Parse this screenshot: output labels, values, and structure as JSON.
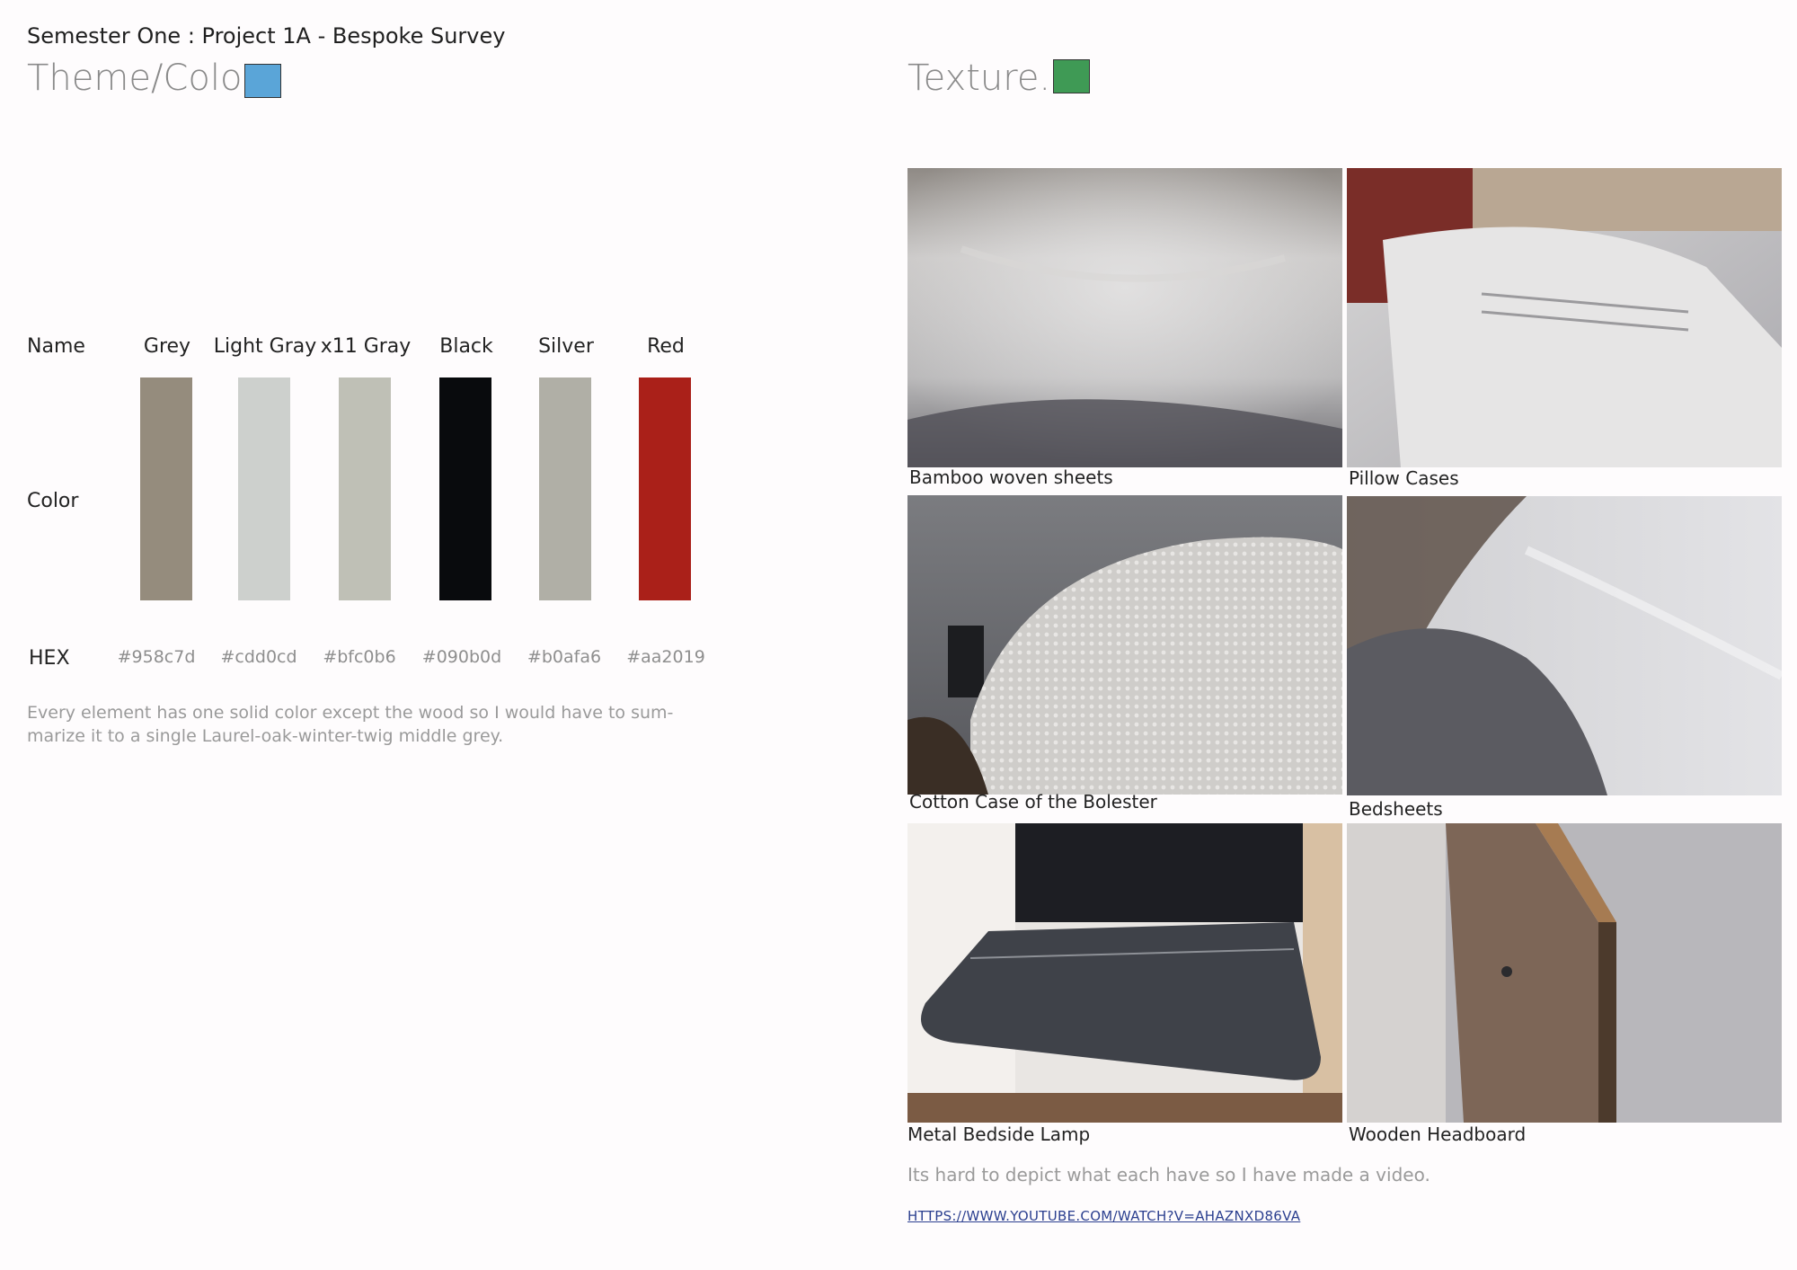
{
  "header": {
    "project_title": "Semester One : Project 1A - Bespoke Survey"
  },
  "theme": {
    "title": "Theme/Color",
    "title_square_color": "#5aa5d8",
    "row_labels": {
      "name": "Name",
      "color": "Color",
      "hex": "HEX"
    },
    "swatches": [
      {
        "name": "Grey",
        "hex": "#958c7d"
      },
      {
        "name": "Light Gray",
        "hex": "#cdd0cd"
      },
      {
        "name": "x11 Gray",
        "hex": "#bfc0b6"
      },
      {
        "name": "Black",
        "hex": "#090b0d"
      },
      {
        "name": "Silver",
        "hex": "#b0afa6"
      },
      {
        "name": "Red",
        "hex": "#aa2019"
      }
    ],
    "note": "Every element has one solid color except the wood so I would have to sum-marize it to a single Laurel-oak-winter-twig middle grey."
  },
  "texture": {
    "title": "Texture.",
    "title_square_color": "#3f9a55",
    "photos": [
      {
        "caption": "Bamboo woven sheets",
        "icon": "bamboo-sheets-photo"
      },
      {
        "caption": "Pillow Cases",
        "icon": "pillow-case-photo"
      },
      {
        "caption": "Cotton Case of the Bolester",
        "icon": "bolster-case-photo"
      },
      {
        "caption": "Bedsheets",
        "icon": "bedsheets-photo"
      },
      {
        "caption": "Metal Bedside Lamp",
        "icon": "metal-lamp-photo"
      },
      {
        "caption": "Wooden Headboard",
        "icon": "wooden-headboard-photo"
      }
    ],
    "video_note": "Its hard to depict what each have so I have made a video.",
    "video_link": "HTTPS://WWW.YOUTUBE.COM/WATCH?V=AHAZNXD86VA"
  }
}
